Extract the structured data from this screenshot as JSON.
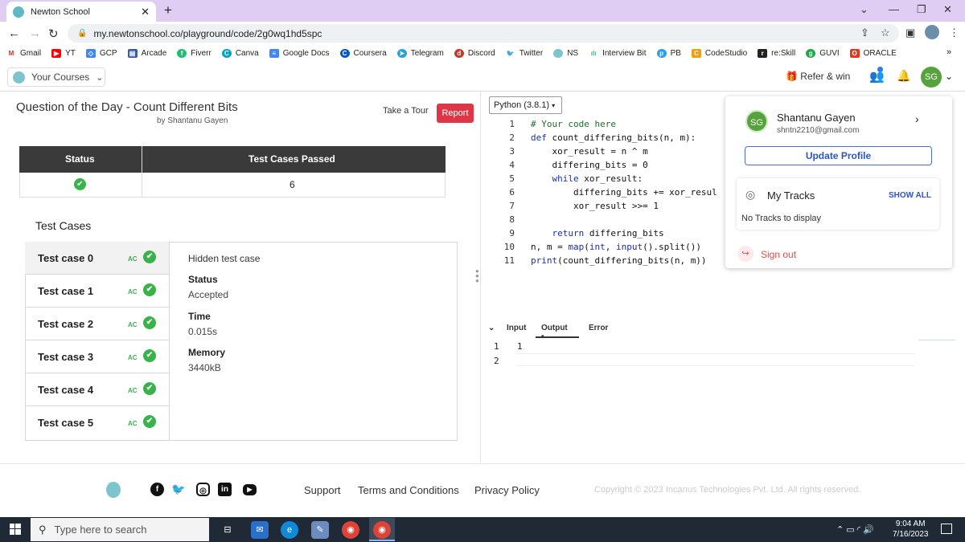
{
  "browser": {
    "tab_title": "Newton School",
    "new_tab": "+",
    "url": "my.newtonschool.co/playground/code/2g0wq1hd5spc",
    "bookmarks": [
      "Gmail",
      "YT",
      "GCP",
      "Arcade",
      "Fiverr",
      "Canva",
      "Google Docs",
      "Coursera",
      "Telegram",
      "Discord",
      "Twitter",
      "NS",
      "Interview Bit",
      "PB",
      "CodeStudio",
      "re:Skill",
      "GUVI",
      "ORACLE"
    ],
    "more": "»"
  },
  "header": {
    "courses_label": "Your Courses",
    "refer_label": "Refer & win",
    "avatar_initials": "SG"
  },
  "question": {
    "title": "Question of the Day - Count Different Bits",
    "author": "by Shantanu Gayen",
    "tour_label": "Take a Tour",
    "report_label": "Report"
  },
  "status_table": {
    "headers": [
      "Status",
      "Test Cases Passed"
    ],
    "passed": "6"
  },
  "test_cases": {
    "title": "Test Cases",
    "items": [
      {
        "name": "Test case 0",
        "verdict": "AC"
      },
      {
        "name": "Test case 1",
        "verdict": "AC"
      },
      {
        "name": "Test case 2",
        "verdict": "AC"
      },
      {
        "name": "Test case 3",
        "verdict": "AC"
      },
      {
        "name": "Test case 4",
        "verdict": "AC"
      },
      {
        "name": "Test case 5",
        "verdict": "AC"
      }
    ],
    "detail": {
      "hidden": "Hidden test case",
      "status_label": "Status",
      "status_value": "Accepted",
      "time_label": "Time",
      "time_value": "0.015s",
      "memory_label": "Memory",
      "memory_value": "3440kB"
    }
  },
  "editor": {
    "language": "Python (3.8.1)",
    "lines": [
      "# Your code here",
      "def count_differing_bits(n, m):",
      "    xor_result = n ^ m",
      "    differing_bits = 0",
      "    while xor_result:",
      "        differing_bits += xor_resul",
      "        xor_result >>= 1",
      "",
      "    return differing_bits",
      "n, m = map(int, input().split())",
      "print(count_differing_bits(n, m))"
    ],
    "line_numbers": [
      "1",
      "2",
      "3",
      "4",
      "5",
      "6",
      "7",
      "8",
      "9",
      "10",
      "11"
    ]
  },
  "io": {
    "tabs": [
      "Input",
      "Output •",
      "Error"
    ],
    "line_numbers": [
      "1",
      "2"
    ],
    "value": "1"
  },
  "profile_menu": {
    "initials": "SG",
    "name": "Shantanu Gayen",
    "email": "shntn2210@gmail.com",
    "update_label": "Update Profile",
    "tracks_label": "My Tracks",
    "show_all": "SHOW ALL",
    "no_tracks": "No Tracks to display",
    "sign_out": "Sign out"
  },
  "footer": {
    "links": [
      "Support",
      "Terms and Conditions",
      "Privacy Policy"
    ],
    "copyright": "Copyright © 2023 Incanus Technologies Pvt. Ltd. All rights reserved."
  },
  "taskbar": {
    "search_placeholder": "Type here to search",
    "time": "9:04 AM",
    "date": "7/16/2023"
  },
  "colors": {
    "tabstrip": "#dfcdf4",
    "report": "#e03545",
    "accepted": "#37b34a",
    "link_blue": "#2b56c8",
    "taskbar": "#1f2a36"
  }
}
